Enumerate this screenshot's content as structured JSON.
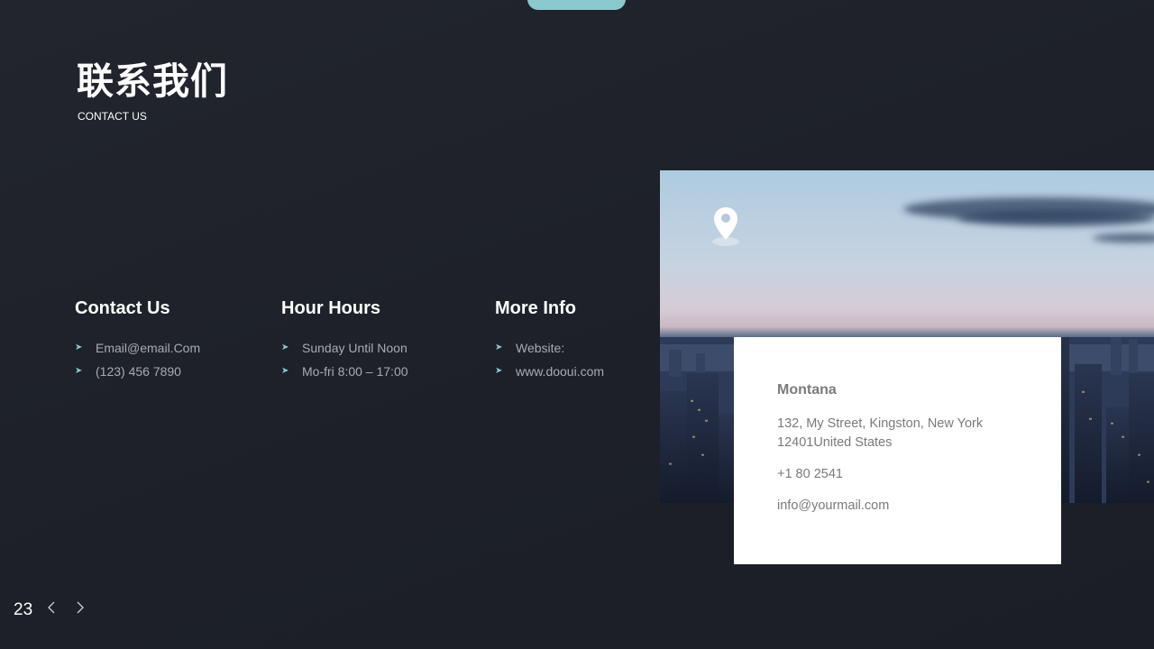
{
  "header": {
    "title_cn": "联系我们",
    "title_en": "CONTACT US"
  },
  "columns": [
    {
      "heading": "Contact Us",
      "items": [
        "Email@email.Com",
        "(123) 456 7890"
      ]
    },
    {
      "heading": "Hour Hours",
      "items": [
        "Sunday Until Noon",
        "Mo-fri 8:00 – 17:00"
      ]
    },
    {
      "heading": "More Info",
      "items": [
        "Website:",
        "www.dooui.com"
      ]
    }
  ],
  "card": {
    "name": "Montana",
    "address": "132, My Street, Kingston, New York 12401United  States",
    "phone": "+1 80 2541",
    "email": "info@yourmail.com"
  },
  "footer": {
    "page_number": "23"
  },
  "colors": {
    "accent": "#8cc9cf",
    "background": "#1e212a",
    "card": "#ffffff"
  },
  "icons": {
    "location": "map-pin-icon",
    "bullet": "arrowhead-icon",
    "prev": "chevron-left-icon",
    "next": "chevron-right-icon"
  }
}
